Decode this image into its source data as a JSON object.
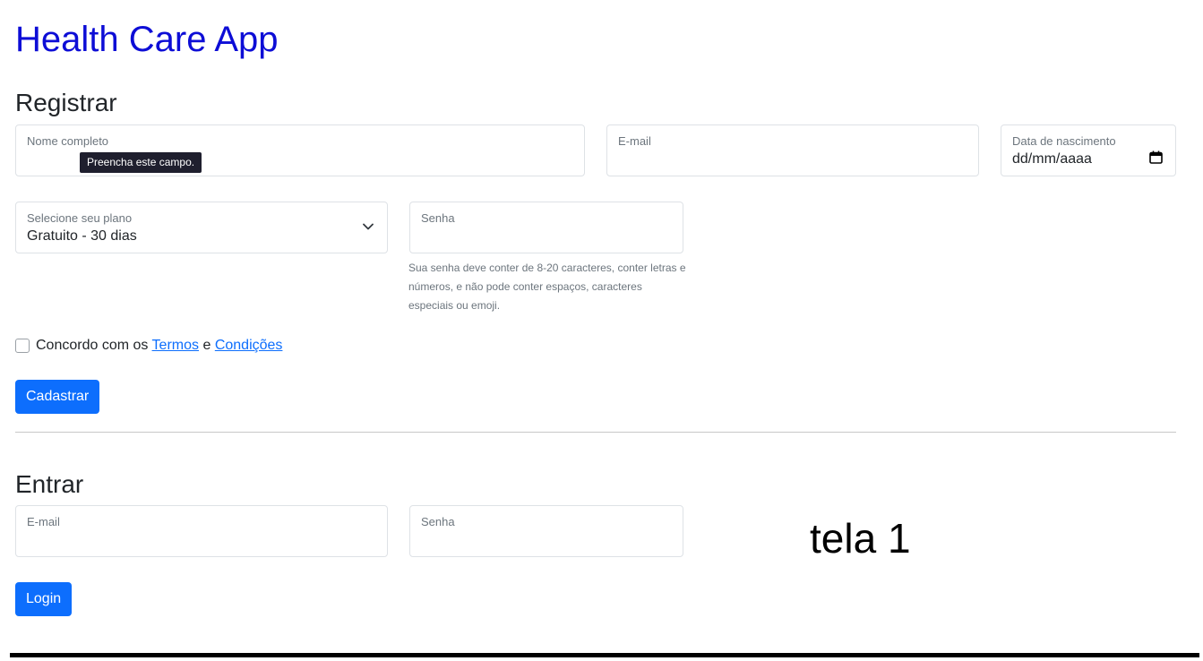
{
  "app": {
    "title": "Health Care App"
  },
  "register": {
    "heading": "Registrar",
    "full_name": {
      "label": "Nome completo",
      "value": ""
    },
    "tooltip": "Preencha este campo.",
    "email": {
      "label": "E-mail",
      "value": ""
    },
    "birthdate": {
      "label": "Data de nascimento",
      "value": "dd/mm/aaaa",
      "icon": "calendar-icon"
    },
    "plan": {
      "label": "Selecione seu plano",
      "value": "Gratuito - 30 dias",
      "icon": "chevron-down-icon"
    },
    "password": {
      "label": "Senha",
      "value": "",
      "help": "Sua senha deve conter de 8-20 caracteres, conter letras e números, e não pode conter espaços, caracteres especiais ou emoji."
    },
    "terms": {
      "prefix": "Concordo com os",
      "terms_link": "Termos",
      "joiner": "e",
      "conditions_link": "Condições",
      "checked": false
    },
    "submit_label": "Cadastrar"
  },
  "login": {
    "heading": "Entrar",
    "email": {
      "label": "E-mail",
      "value": ""
    },
    "password": {
      "label": "Senha",
      "value": ""
    },
    "submit_label": "Login"
  },
  "screen_label": "tela 1",
  "colors": {
    "title": "#0d0dd6",
    "primary": "#0d6efd",
    "border": "#dee2e6",
    "muted": "#6c757d"
  }
}
